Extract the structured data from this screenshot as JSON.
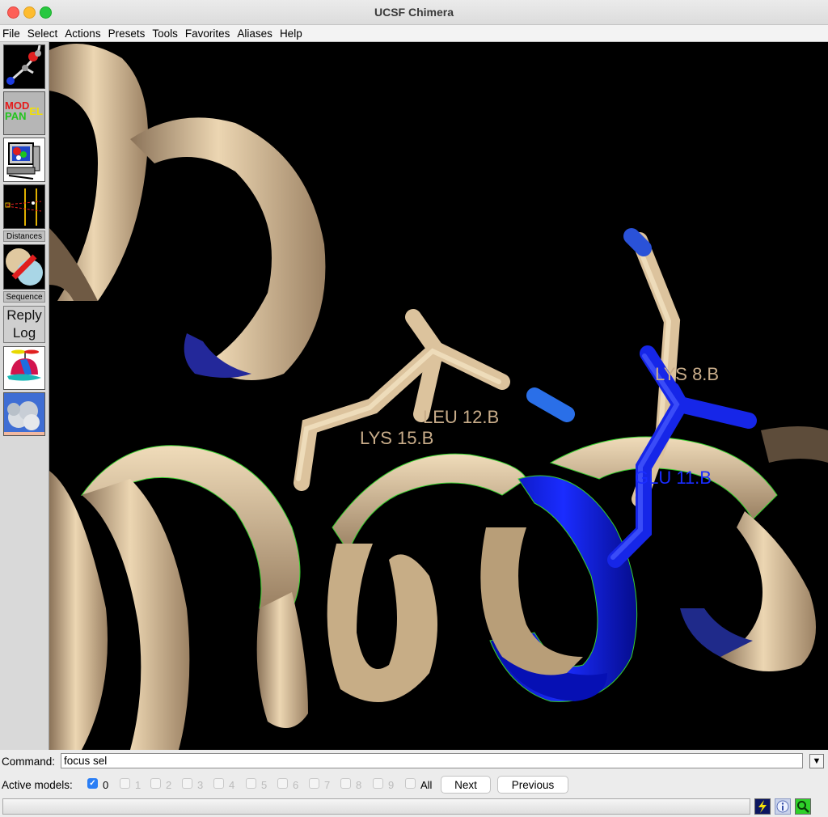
{
  "window": {
    "title": "UCSF Chimera"
  },
  "menu": [
    "File",
    "Select",
    "Actions",
    "Presets",
    "Tools",
    "Favorites",
    "Aliases",
    "Help"
  ],
  "toolbar": {
    "model_panel_text_1": "MOD",
    "model_panel_text_2": "EL",
    "model_panel_text_3": "PAN",
    "distances_label": "Distances",
    "sequence_label": "Sequence",
    "reply_log_line1": "Reply",
    "reply_log_line2": "Log"
  },
  "viewer": {
    "labels": [
      {
        "text": "LYS 8.B",
        "color": "#c9ad8a"
      },
      {
        "text": "LEU 12.B",
        "color": "#c9ad8a"
      },
      {
        "text": "LYS 15.B",
        "color": "#c9ad8a"
      },
      {
        "text": "GLU 11.B",
        "color": "#1a2cff"
      }
    ],
    "ribbon_color": "#e3c9a2",
    "selected_color": "#0a14e6",
    "outline_color": "#37d12e",
    "background": "#000000"
  },
  "command": {
    "label": "Command:",
    "value": "focus sel",
    "dropdown_glyph": "▼"
  },
  "models": {
    "label": "Active models:",
    "checkboxes": [
      {
        "label": "0",
        "checked": true
      },
      {
        "label": "1",
        "checked": false
      },
      {
        "label": "2",
        "checked": false
      },
      {
        "label": "3",
        "checked": false
      },
      {
        "label": "4",
        "checked": false
      },
      {
        "label": "5",
        "checked": false
      },
      {
        "label": "6",
        "checked": false
      },
      {
        "label": "7",
        "checked": false
      },
      {
        "label": "8",
        "checked": false
      },
      {
        "label": "9",
        "checked": false
      }
    ],
    "all_label": "All",
    "next_label": "Next",
    "previous_label": "Previous"
  },
  "status": {
    "text": ""
  }
}
